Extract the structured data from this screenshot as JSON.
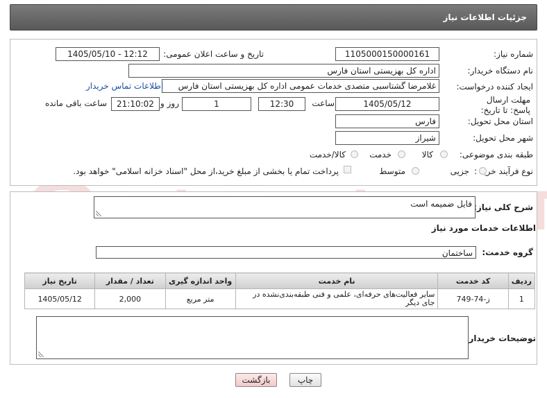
{
  "header": {
    "title": "جزئیات اطلاعات نیاز"
  },
  "form": {
    "need_number_label": "شماره نیاز:",
    "need_number": "1105000150000161",
    "announce_label": "تاریخ و ساعت اعلان عمومی:",
    "announce_value": "1405/05/10 - 12:12",
    "buyer_org_label": "نام دستگاه خریدار:",
    "buyer_org": "اداره کل بهزیستی استان فارس",
    "creator_label": "ایجاد کننده درخواست:",
    "creator": "غلامرضا گشتاسبی متصدی خدمات عمومی اداره کل بهزیستی استان فارس",
    "contact_link": "اطلاعات تماس خریدار",
    "deadline_label": "مهلت ارسال پاسخ: تا تاریخ:",
    "deadline_date": "1405/05/12",
    "time_label": "ساعت",
    "deadline_time": "12:30",
    "days_value": "1",
    "days_label": "روز و",
    "remaining_value": "21:10:02",
    "remaining_label": "ساعت باقی مانده",
    "province_label": "استان محل تحویل:",
    "province": "فارس",
    "city_label": "شهر محل تحویل:",
    "city": "شیراز",
    "category_label": "طبقه بندی موضوعی:",
    "category_options": [
      "کالا",
      "خدمت",
      "کالا/خدمت"
    ],
    "purchase_type_label": "نوع فرآیند خرید :",
    "purchase_options": [
      "جزیی",
      "متوسط"
    ],
    "payment_note": "پرداخت تمام یا بخشی از مبلغ خرید،از محل \"اسناد خزانه اسلامی\" خواهد بود."
  },
  "summary": {
    "label": "شرح کلی نیاز:",
    "value": "فایل ضمیمه است"
  },
  "services": {
    "section_title": "اطلاعات خدمات مورد نیاز",
    "group_label": "گروه خدمت:",
    "group_value": "ساختمان",
    "columns": [
      "ردیف",
      "کد خدمت",
      "نام خدمت",
      "واحد اندازه گیری",
      "تعداد / مقدار",
      "تاریخ نیاز"
    ],
    "rows": [
      [
        "1",
        "ز-74-749",
        "سایر فعالیت‌های حرفه‌ای، علمی و فنی طبقه‌بندی‌نشده در جای دیگر",
        "متر مربع",
        "2,000",
        "1405/05/12"
      ]
    ]
  },
  "buyer_notes": {
    "label": "توضیحات خریدار:",
    "value": ""
  },
  "buttons": {
    "print": "چاپ",
    "back": "بازگشت"
  },
  "watermark": {
    "text": "AriaTender.neT"
  },
  "colors": {
    "header_bg": "#666666",
    "link": "#1a4fa0",
    "back_btn": "#f7d6d6",
    "print_btn": "#eeeeee"
  }
}
